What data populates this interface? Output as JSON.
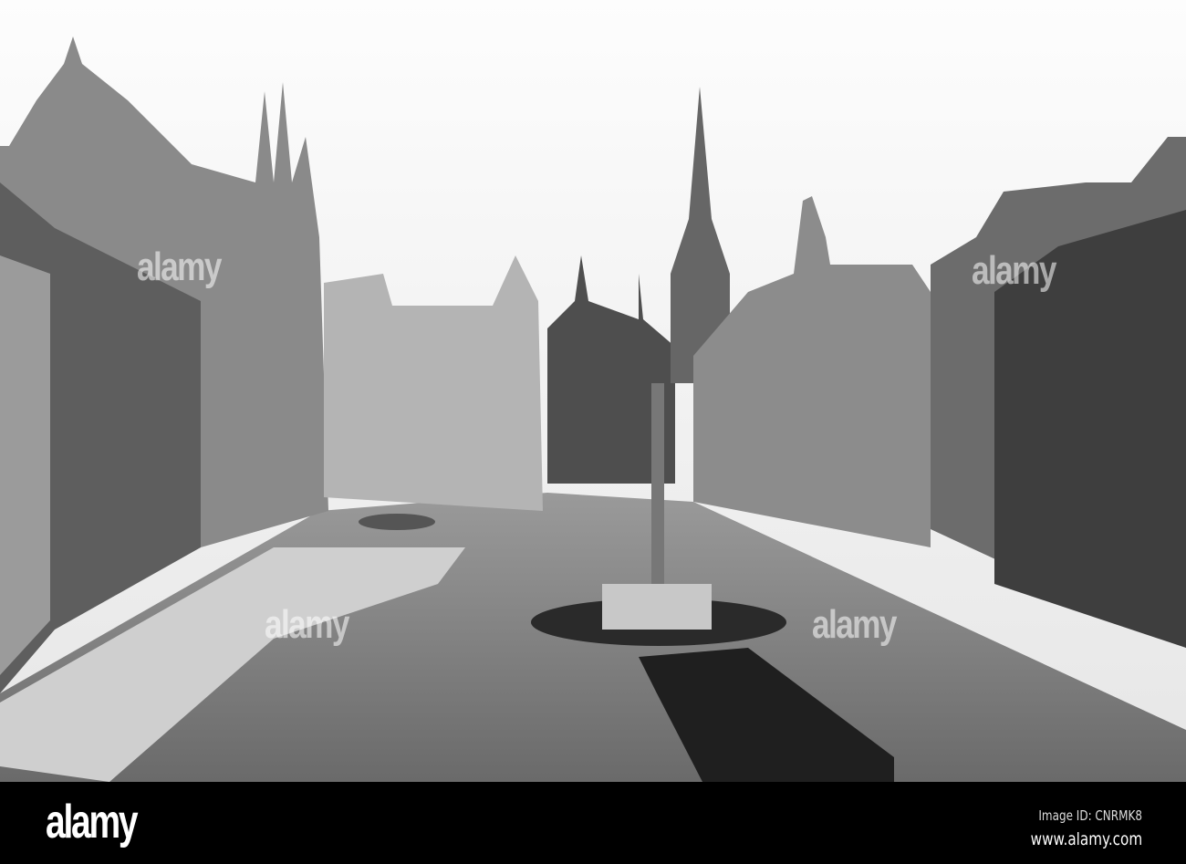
{
  "photo": {
    "subject": "historic-city-square",
    "watermark_text": "alamy"
  },
  "footer": {
    "logo": "alamy",
    "image_id": "Image ID: CNRMK8",
    "website": "www.alamy.com"
  }
}
